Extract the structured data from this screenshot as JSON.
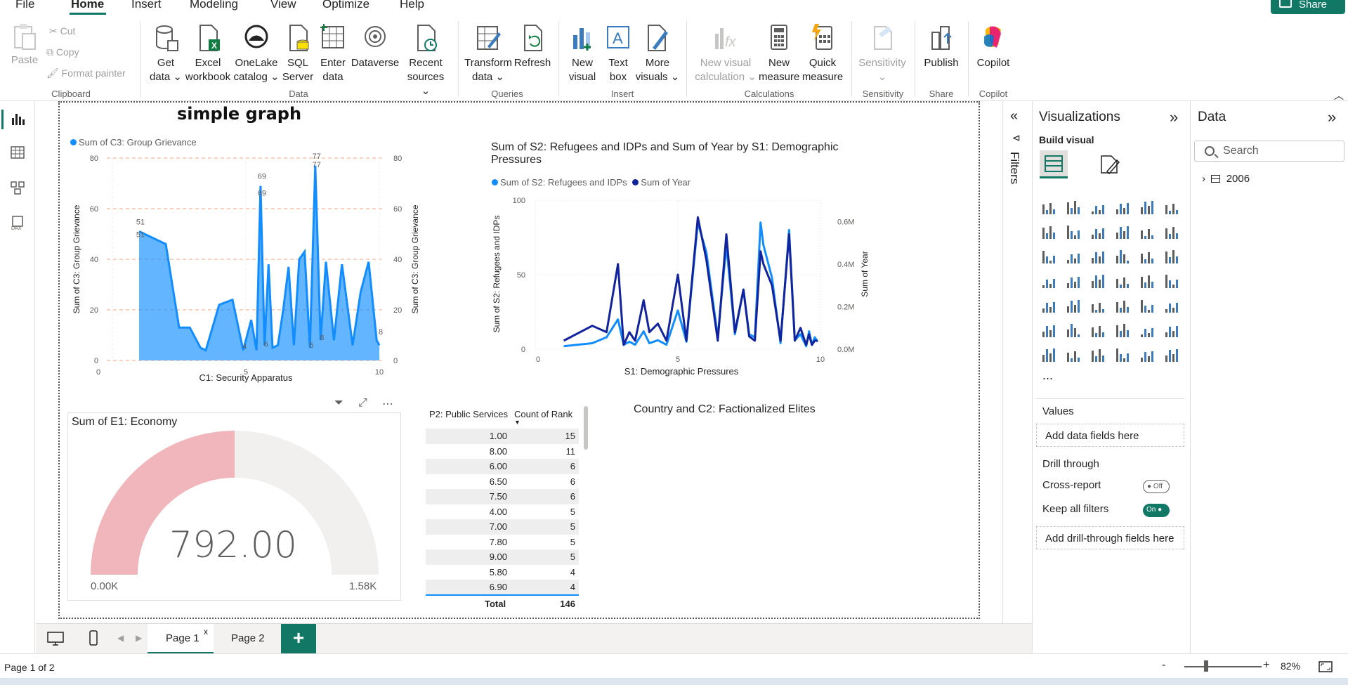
{
  "menu": {
    "items": [
      "File",
      "Home",
      "Insert",
      "Modeling",
      "View",
      "Optimize",
      "Help"
    ],
    "active": "Home",
    "share": "Share"
  },
  "ribbon": {
    "clipboard": {
      "paste": "Paste",
      "cut": "Cut",
      "copy": "Copy",
      "format_painter": "Format painter",
      "label": "Clipboard"
    },
    "data": {
      "get_data": [
        "Get",
        "data ⌄"
      ],
      "excel": [
        "Excel",
        "workbook"
      ],
      "onelake": [
        "OneLake",
        "catalog ⌄"
      ],
      "sql": [
        "SQL",
        "Server"
      ],
      "enter": [
        "Enter",
        "data"
      ],
      "dataverse": [
        "Dataverse",
        ""
      ],
      "recent": [
        "Recent",
        "sources ⌄"
      ],
      "label": "Data"
    },
    "queries": {
      "transform": [
        "Transform",
        "data ⌄"
      ],
      "refresh": [
        "Refresh",
        ""
      ],
      "label": "Queries"
    },
    "insert": {
      "new_visual": [
        "New",
        "visual"
      ],
      "text_box": [
        "Text",
        "box"
      ],
      "more_visuals": [
        "More",
        "visuals ⌄"
      ],
      "label": "Insert"
    },
    "calculations": {
      "new_visual_calc": [
        "New visual",
        "calculation ⌄"
      ],
      "new_measure": [
        "New",
        "measure"
      ],
      "quick_measure": [
        "Quick",
        "measure"
      ],
      "label": "Calculations"
    },
    "sensitivity": {
      "btn": [
        "Sensitivity",
        "⌄"
      ],
      "label": "Sensitivity"
    },
    "share": {
      "publish": [
        "Publish",
        ""
      ],
      "label": "Share"
    },
    "copilot": {
      "btn": [
        "Copilot",
        ""
      ],
      "label": "Copilot"
    }
  },
  "report": {
    "simple_graph": {
      "title": "simple graph",
      "legend": "Sum of C3: Group Grievance",
      "xlabel": "C1: Security Apparatus",
      "ylabel": "Sum of C3: Group Grievance",
      "ylabel_right": "Sum of C3: Group Grievance"
    },
    "line_chart": {
      "title": "Sum of S2: Refugees and IDPs and Sum of Year by S1: Demographic Pressures",
      "legend1": "Sum of S2: Refugees and IDPs",
      "legend2": "Sum of Year",
      "xlabel": "S1: Demographic Pressures",
      "ylabel": "Sum of S2: Refugees and IDPs",
      "ylabel_right": "Sum of Year"
    },
    "gauge": {
      "title": "Sum of E1: Economy",
      "value": "792.00",
      "min": "0.00K",
      "max": "1.58K",
      "fraction": 0.5
    },
    "table": {
      "col1": "P2: Public Services",
      "col2": "Count of Rank",
      "rows": [
        [
          "1.00",
          "15"
        ],
        [
          "8.00",
          "11"
        ],
        [
          "6.00",
          "6"
        ],
        [
          "6.50",
          "6"
        ],
        [
          "7.50",
          "6"
        ],
        [
          "4.00",
          "5"
        ],
        [
          "7.00",
          "5"
        ],
        [
          "7.80",
          "5"
        ],
        [
          "9.00",
          "5"
        ],
        [
          "5.80",
          "4"
        ],
        [
          "6.90",
          "4"
        ]
      ],
      "total_label": "Total",
      "total_value": "146"
    },
    "country_title": "Country and C2: Factionalized Elites"
  },
  "chart_data": [
    {
      "type": "area",
      "title": "simple graph",
      "xlabel": "C1: Security Apparatus",
      "ylabel": "Sum of C3: Group Grievance",
      "xlim": [
        0,
        10
      ],
      "ylim": [
        0,
        80
      ],
      "x_ticks": [
        "0",
        "5",
        "10"
      ],
      "y_ticks": [
        "0",
        "20",
        "40",
        "60",
        "80"
      ],
      "grid": "dashed horizontal",
      "legend": "top-left",
      "color": "#118dff",
      "series": [
        {
          "name": "Sum of C3: Group Grievance",
          "x": [
            1.0,
            2.0,
            2.5,
            2.9,
            3.3,
            3.5,
            4.0,
            4.5,
            4.9,
            5.2,
            5.4,
            5.55,
            5.7,
            5.85,
            6.0,
            6.2,
            6.4,
            6.6,
            6.8,
            7.0,
            7.2,
            7.4,
            7.6,
            7.8,
            8.0,
            8.3,
            8.6,
            9.0,
            9.3,
            9.6,
            9.9,
            10.0
          ],
          "y": [
            51,
            46,
            13,
            13,
            5,
            4,
            22,
            24,
            4,
            16,
            4,
            69,
            6,
            38,
            5,
            6,
            20,
            37,
            6,
            40,
            43,
            5,
            77,
            8,
            39,
            8,
            38,
            6,
            27,
            39,
            8,
            6
          ],
          "labels": [
            "51",
            "51",
            "69",
            "69",
            "77",
            "77",
            "4",
            "6",
            "5",
            "8",
            "8"
          ]
        }
      ]
    },
    {
      "type": "line",
      "title": "Sum of S2: Refugees and IDPs and Sum of Year by S1: Demographic Pressures",
      "xlabel": "S1: Demographic Pressures",
      "ylabel": "Sum of S2: Refugees and IDPs",
      "ylabel_right": "Sum of Year",
      "xlim": [
        0,
        10
      ],
      "ylim": [
        0,
        100
      ],
      "ylim_right": [
        0,
        0.7
      ],
      "x_ticks": [
        "0",
        "5",
        "10"
      ],
      "y_ticks": [
        "0",
        "50",
        "100"
      ],
      "y_ticks_right": [
        "0.0M",
        "0.2M",
        "0.4M",
        "0.6M"
      ],
      "legend": "top-left",
      "x": [
        1.0,
        2.0,
        2.5,
        2.9,
        3.1,
        3.3,
        3.5,
        3.8,
        4.0,
        4.3,
        4.6,
        5.0,
        5.3,
        5.7,
        6.0,
        6.4,
        6.7,
        7.0,
        7.3,
        7.5,
        7.7,
        7.9,
        8.0,
        8.3,
        8.6,
        8.9,
        9.1,
        9.3,
        9.5,
        9.6,
        9.7,
        9.8,
        9.9
      ],
      "series": [
        {
          "name": "Sum of S2: Refugees and IDPs",
          "color": "#118dff",
          "values": [
            2,
            4,
            8,
            20,
            3,
            5,
            3,
            12,
            4,
            6,
            3,
            26,
            5,
            85,
            65,
            8,
            70,
            10,
            40,
            10,
            8,
            85,
            70,
            48,
            4,
            80,
            6,
            10,
            2,
            12,
            3,
            8,
            5
          ]
        },
        {
          "name": "Sum of Year",
          "color": "#12239e",
          "values": [
            0.04,
            0.11,
            0.08,
            0.4,
            0.02,
            0.08,
            0.04,
            0.23,
            0.08,
            0.12,
            0.04,
            0.35,
            0.04,
            0.62,
            0.42,
            0.04,
            0.54,
            0.08,
            0.28,
            0.06,
            0.04,
            0.46,
            0.4,
            0.3,
            0.04,
            0.54,
            0.04,
            0.1,
            0.02,
            0.07,
            0.02,
            0.04,
            0.04
          ]
        }
      ]
    }
  ],
  "filters": {
    "label": "Filters"
  },
  "visualizations": {
    "title": "Visualizations",
    "build_visual": "Build visual",
    "values_label": "Values",
    "values_placeholder": "Add data fields here",
    "drill_through": "Drill through",
    "cross_report": "Cross-report",
    "cross_report_state": "Off",
    "keep_filters": "Keep all filters",
    "keep_filters_state": "On",
    "drill_placeholder": "Add drill-through fields here",
    "more": "..."
  },
  "data_pane": {
    "title": "Data",
    "search_placeholder": "Search",
    "table_name": "2006"
  },
  "pages": {
    "tabs": [
      "Page 1",
      "Page 2"
    ],
    "active": "Page 1",
    "close": "x",
    "add": "+"
  },
  "status": {
    "page": "Page 1 of 2",
    "zoom": "82%"
  }
}
